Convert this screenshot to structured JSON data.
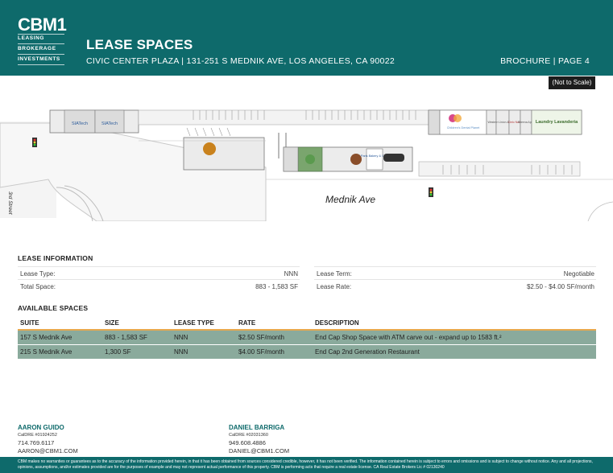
{
  "brand": {
    "logo_text": "CBM1",
    "logo_lines": [
      "LEASING",
      "BROKERAGE",
      "INVESTMENTS"
    ]
  },
  "header": {
    "title": "LEASE SPACES",
    "subtitle": "CIVIC CENTER PLAZA | 131-251 S MEDNIK AVE, LOS ANGELES, CA 90022",
    "page_label": "BROCHURE | PAGE 4"
  },
  "map": {
    "scale_note": "(Not to Scale)",
    "street_main": "Mednik Ave",
    "street_side": "3rd Street",
    "tenants": [
      "SIATech",
      "SIATech",
      "Paris Bakery & Cafe",
      "Children's Dental Planet",
      "Laundry Lavanderia",
      "Cielo Nails",
      "Sheena Apus",
      "Western Union & Liquor"
    ]
  },
  "lease_info": {
    "heading": "LEASE INFORMATION",
    "left": [
      {
        "label": "Lease Type:",
        "value": "NNN"
      },
      {
        "label": "Total Space:",
        "value": "883 - 1,583 SF"
      }
    ],
    "right": [
      {
        "label": "Lease Term:",
        "value": "Negotiable"
      },
      {
        "label": "Lease Rate:",
        "value": "$2.50 - $4.00 SF/month"
      }
    ]
  },
  "available": {
    "heading": "AVAILABLE SPACES",
    "columns": [
      "SUITE",
      "SIZE",
      "LEASE TYPE",
      "RATE",
      "DESCRIPTION"
    ],
    "rows": [
      [
        "157 S Mednik Ave",
        "883 - 1,583 SF",
        "NNN",
        "$2.50 SF/month",
        "End Cap Shop Space with ATM carve out - expand up to 1583 ft.²"
      ],
      [
        "215 S Mednik Ave",
        "1,300 SF",
        "NNN",
        "$4.00 SF/month",
        "End Cap 2nd Generation Restaurant"
      ]
    ]
  },
  "contacts": [
    {
      "name": "AARON GUIDO",
      "license": "CalDRE #01924252",
      "phone": "714.769.6117",
      "email": "AARON@CBM1.COM"
    },
    {
      "name": "DANIEL BARRIGA",
      "license": "CalDRE #02031360",
      "phone": "949.608.4886",
      "email": "DANIEL@CBM1.COM"
    }
  ],
  "footer": {
    "disclaimer": "CBM makes no warranties or guarantees as to the accuracy of the information provided herein, in that it has been obtained from sources considered credible, however, it has not been verified. The information contained herein is subject to errors and omissions and is subject to change without notice. Any and all projections, opinions, assumptions, and/or estimates provided are for the purposes of example and may not represent actual performance of this property. CBM is performing acts that require a real estate license. CA Real Estate Brokers Lic # 02130240"
  },
  "colors": {
    "brand_teal": "#0e6a6b",
    "row_fill": "#8aaa9c",
    "row_accent": "#e8a84e"
  }
}
